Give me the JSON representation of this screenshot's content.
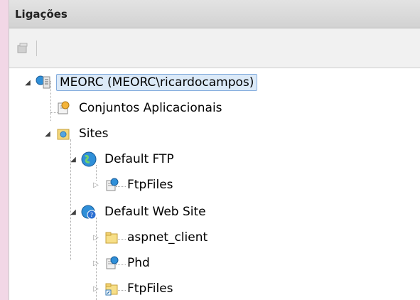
{
  "panel": {
    "title": "Ligações"
  },
  "toolbar": {
    "icons": [
      "connect-icon"
    ]
  },
  "tree": {
    "server": {
      "label": "MEORC (MEORC\\ricardocampos)",
      "icon": "server-icon"
    },
    "app_pools": {
      "label": "Conjuntos Aplicacionais",
      "icon": "app-pool-icon"
    },
    "sites": {
      "label": "Sites",
      "icon": "sites-folder-icon"
    },
    "ftp_site": {
      "label": "Default FTP",
      "icon": "globe-icon"
    },
    "ftp_files": {
      "label": "FtpFiles",
      "icon": "virtual-dir-icon"
    },
    "web_site": {
      "label": "Default Web Site",
      "icon": "globe-question-icon"
    },
    "aspnet_client": {
      "label": "aspnet_client",
      "icon": "folder-icon"
    },
    "phd": {
      "label": "Phd",
      "icon": "app-icon"
    },
    "ftpfiles2": {
      "label": "FtpFiles",
      "icon": "folder-shortcut-icon"
    }
  }
}
